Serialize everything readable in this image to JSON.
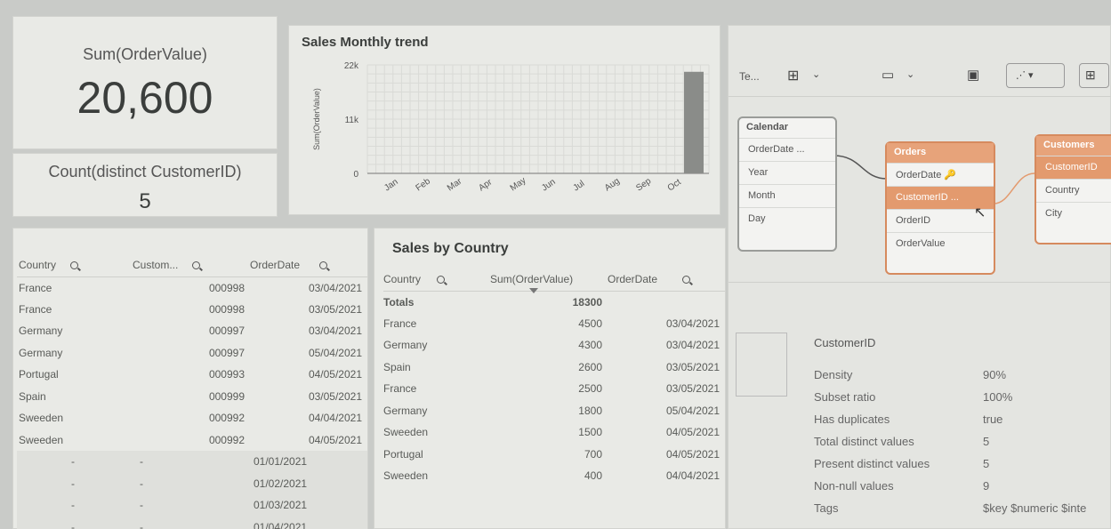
{
  "kpi1": {
    "label": "Sum(OrderValue)",
    "value": "20,600"
  },
  "kpi2": {
    "label": "Count(distinct CustomerID)",
    "value": "5"
  },
  "monthly_chart": {
    "title": "Sales Monthly trend"
  },
  "chart_data": {
    "type": "bar",
    "title": "Sales Monthly trend",
    "xlabel": "",
    "ylabel": "Sum(OrderValue)",
    "categories": [
      "Jan",
      "Feb",
      "Mar",
      "Apr",
      "May",
      "Jun",
      "Jul",
      "Aug",
      "Sep",
      "Oct"
    ],
    "tick_labels": [
      "Jan",
      "Feb",
      "Mar",
      "Apr",
      "May",
      "Jun",
      "Jul",
      "Aug",
      "Sep",
      "Oct"
    ],
    "values": [
      0,
      0,
      0,
      0,
      0,
      0,
      0,
      0,
      0,
      20600
    ],
    "y_ticks": [
      "22k",
      "11k",
      "0"
    ],
    "ylim": [
      0,
      22000
    ],
    "grid": true,
    "colors": {
      "bar": "#8a8c89",
      "grid": "#d9dad6"
    }
  },
  "left_table": {
    "headers": [
      "Country",
      "Custom...",
      "OrderDate"
    ],
    "rows": [
      [
        "France",
        "000998",
        "03/04/2021"
      ],
      [
        "France",
        "000998",
        "03/05/2021"
      ],
      [
        "Germany",
        "000997",
        "03/04/2021"
      ],
      [
        "Germany",
        "000997",
        "05/04/2021"
      ],
      [
        "Portugal",
        "000993",
        "04/05/2021"
      ],
      [
        "Spain",
        "000999",
        "03/05/2021"
      ],
      [
        "Sweeden",
        "000992",
        "04/04/2021"
      ],
      [
        "Sweeden",
        "000992",
        "04/05/2021"
      ],
      [
        "-",
        "-",
        "01/01/2021"
      ],
      [
        "-",
        "-",
        "01/02/2021"
      ],
      [
        "-",
        "-",
        "01/03/2021"
      ],
      [
        "-",
        "-",
        "01/04/2021"
      ]
    ]
  },
  "country_table": {
    "title": "Sales by Country",
    "headers": [
      "Country",
      "Sum(OrderValue)",
      "OrderDate"
    ],
    "totals_label": "Totals",
    "totals_value": "18300",
    "rows": [
      [
        "France",
        "4500",
        "03/04/2021"
      ],
      [
        "Germany",
        "4300",
        "03/04/2021"
      ],
      [
        "Spain",
        "2600",
        "03/05/2021"
      ],
      [
        "France",
        "2500",
        "03/05/2021"
      ],
      [
        "Germany",
        "1800",
        "05/04/2021"
      ],
      [
        "Sweeden",
        "1500",
        "04/05/2021"
      ],
      [
        "Portugal",
        "700",
        "04/05/2021"
      ],
      [
        "Sweeden",
        "400",
        "04/04/2021"
      ]
    ]
  },
  "model_viewer": {
    "toolbar": {
      "tab_label": "Te..."
    },
    "tables": {
      "calendar": {
        "name": "Calendar",
        "fields": [
          "OrderDate ...",
          "Year",
          "Month",
          "Day"
        ]
      },
      "orders": {
        "name": "Orders",
        "fields": [
          "OrderDate",
          "CustomerID ...",
          "OrderID",
          "OrderValue"
        ]
      },
      "customers": {
        "name": "Customers",
        "fields": [
          "CustomerID",
          "Country",
          "City"
        ]
      }
    },
    "colors": {
      "selected": "#e39a6e",
      "header": "#e7a37a",
      "line": "#555555"
    }
  },
  "properties": {
    "title": "CustomerID",
    "rows": [
      [
        "Density",
        "90%"
      ],
      [
        "Subset ratio",
        "100%"
      ],
      [
        "Has duplicates",
        "true"
      ],
      [
        "Total distinct values",
        "5"
      ],
      [
        "Present distinct values",
        "5"
      ],
      [
        "Non-null values",
        "9"
      ],
      [
        "Tags",
        "$key $numeric $inte"
      ]
    ]
  }
}
